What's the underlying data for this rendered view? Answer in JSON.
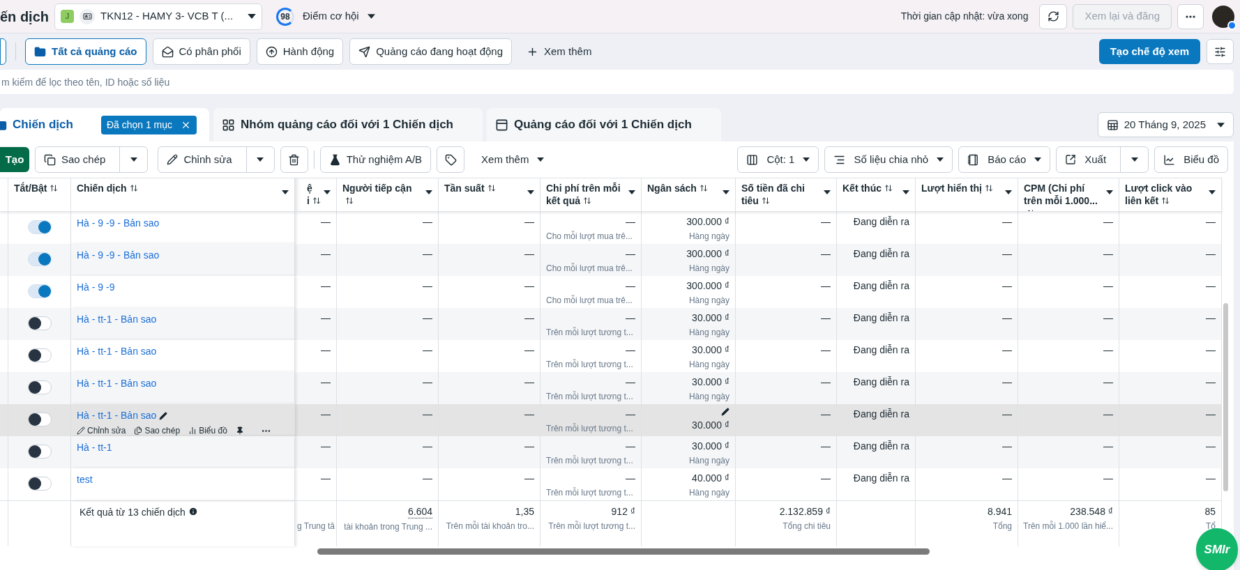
{
  "header": {
    "title": "ến dịch",
    "account_initial": "J",
    "account": "TKN12 - HAMY 3- VCB T (...",
    "score": "98",
    "score_label": "Điểm cơ hội",
    "updated": "Thời gian cập nhật: vừa xong",
    "review_button": {
      "label": "Xem lại và đăng",
      "disabled": true
    }
  },
  "filters": [
    {
      "label": "Tất cả quảng cáo",
      "selected": true
    },
    {
      "label": "Có phân phối",
      "selected": false
    },
    {
      "label": "Hành động",
      "selected": false
    },
    {
      "label": "Quảng cáo đang hoạt động",
      "selected": false
    }
  ],
  "filters_more": "Xem thêm",
  "create_view": "Tạo chế độ xem",
  "search": {
    "placeholder": "m kiếm để lọc theo tên, ID hoặc số liệu"
  },
  "tabs": [
    {
      "label": "Chiến dịch",
      "selected": true,
      "badge": "Đã chọn 1 mục"
    },
    {
      "label": "Nhóm quảng cáo đối với 1 Chiến dịch",
      "selected": false
    },
    {
      "label": "Quảng cáo đối với 1 Chiến dịch",
      "selected": false
    }
  ],
  "date": "20 Tháng 9, 2025",
  "toolbar": {
    "create": "Tạo",
    "copy": "Sao chép",
    "edit": "Chỉnh sửa",
    "ab_test": "Thử nghiệm A/B",
    "more": "Xem thêm",
    "columns": "Cột: 1",
    "breakdown": "Số liệu chia nhỏ",
    "reports": "Báo cáo",
    "export": "Xuất",
    "chart": "Biểu đồ"
  },
  "columns": [
    {
      "label": "Tắt/Bật",
      "sortable": true,
      "menu": false
    },
    {
      "label": "Chiến dịch",
      "sortable": true,
      "menu": true
    },
    {
      "label": "ệ\ni",
      "sortable": true,
      "menu": true
    },
    {
      "label": "Người tiếp cận",
      "sortable": true,
      "menu": true
    },
    {
      "label": "Tần suất",
      "sortable": true,
      "menu": true
    },
    {
      "label": "Chi phí trên mỗi kết quả",
      "sortable": true,
      "menu": true
    },
    {
      "label": "Ngân sách",
      "sortable": true,
      "menu": true
    },
    {
      "label": "Số tiền đã chi tiêu",
      "sortable": true,
      "menu": true
    },
    {
      "label": "Kết thúc",
      "sortable": true,
      "menu": true
    },
    {
      "label": "Lượt hiển thị",
      "sortable": true,
      "menu": true
    },
    {
      "label": "CPM (Chi phí trên mỗi 1.000...",
      "sortable": true,
      "menu": true
    },
    {
      "label": "Lượt click vào liên kết",
      "sortable": true,
      "menu": true
    }
  ],
  "rows": [
    {
      "on": true,
      "hovered": false,
      "name": "Hà - 9 -9 - Bản sao",
      "cells": [
        {
          "value": "—"
        },
        {
          "value": "—"
        },
        {
          "value": "—"
        },
        {
          "value": "—",
          "note": "Cho mỗi lượt mua trê..."
        },
        {
          "value": "300.000 ₫",
          "note": "Hàng ngày"
        },
        {
          "value": "—"
        },
        {
          "value": "Đang diễn ra"
        },
        {
          "value": "—"
        },
        {
          "value": "—"
        },
        {
          "value": "—"
        }
      ]
    },
    {
      "on": true,
      "hovered": false,
      "name": "Hà - 9 -9 - Bản sao",
      "cells": [
        {
          "value": "—"
        },
        {
          "value": "—"
        },
        {
          "value": "—"
        },
        {
          "value": "—",
          "note": "Cho mỗi lượt mua trê..."
        },
        {
          "value": "300.000 ₫",
          "note": "Hàng ngày"
        },
        {
          "value": "—"
        },
        {
          "value": "Đang diễn ra"
        },
        {
          "value": "—"
        },
        {
          "value": "—"
        },
        {
          "value": "—"
        }
      ]
    },
    {
      "on": true,
      "hovered": false,
      "name": "Hà - 9 -9",
      "cells": [
        {
          "value": "—"
        },
        {
          "value": "—"
        },
        {
          "value": "—"
        },
        {
          "value": "—",
          "note": "Cho mỗi lượt mua trê..."
        },
        {
          "value": "300.000 ₫",
          "note": "Hàng ngày"
        },
        {
          "value": "—"
        },
        {
          "value": "Đang diễn ra"
        },
        {
          "value": "—"
        },
        {
          "value": "—"
        },
        {
          "value": "—"
        }
      ]
    },
    {
      "on": false,
      "hovered": false,
      "name": "Hà - tt-1 - Bản sao",
      "cells": [
        {
          "value": "—"
        },
        {
          "value": "—"
        },
        {
          "value": "—"
        },
        {
          "value": "—",
          "note": "Trên mỗi lượt tương t..."
        },
        {
          "value": "30.000 ₫",
          "note": "Hàng ngày"
        },
        {
          "value": "—"
        },
        {
          "value": "Đang diễn ra"
        },
        {
          "value": "—"
        },
        {
          "value": "—"
        },
        {
          "value": "—"
        }
      ]
    },
    {
      "on": false,
      "hovered": false,
      "name": "Hà - tt-1 - Bản sao",
      "cells": [
        {
          "value": "—"
        },
        {
          "value": "—"
        },
        {
          "value": "—"
        },
        {
          "value": "—",
          "note": "Trên mỗi lượt tương t..."
        },
        {
          "value": "30.000 ₫",
          "note": "Hàng ngày"
        },
        {
          "value": "—"
        },
        {
          "value": "Đang diễn ra"
        },
        {
          "value": "—"
        },
        {
          "value": "—"
        },
        {
          "value": "—"
        }
      ]
    },
    {
      "on": false,
      "hovered": false,
      "name": "Hà - tt-1 - Bản sao",
      "cells": [
        {
          "value": "—"
        },
        {
          "value": "—"
        },
        {
          "value": "—"
        },
        {
          "value": "—",
          "note": "Trên mỗi lượt tương t..."
        },
        {
          "value": "30.000 ₫",
          "note": "Hàng ngày"
        },
        {
          "value": "—"
        },
        {
          "value": "Đang diễn ra"
        },
        {
          "value": "—"
        },
        {
          "value": "—"
        },
        {
          "value": "—"
        }
      ]
    },
    {
      "on": false,
      "hovered": true,
      "name": "Hà - tt-1 - Bản sao",
      "actions": [
        "Chỉnh sửa",
        "Sao chép",
        "Biểu đồ"
      ],
      "cells": [
        {
          "value": "—"
        },
        {
          "value": "—"
        },
        {
          "value": "—"
        },
        {
          "value": "—",
          "note": "Trên mỗi lượt tương t..."
        },
        {
          "value": "30.000 ₫"
        },
        {
          "value": "—"
        },
        {
          "value": "Đang diễn ra"
        },
        {
          "value": "—"
        },
        {
          "value": "—"
        },
        {
          "value": "—"
        }
      ]
    },
    {
      "on": false,
      "hovered": false,
      "name": "Hà - tt-1",
      "cells": [
        {
          "value": "—"
        },
        {
          "value": "—"
        },
        {
          "value": "—"
        },
        {
          "value": "—",
          "note": "Trên mỗi lượt tương t..."
        },
        {
          "value": "30.000 ₫",
          "note": "Hàng ngày"
        },
        {
          "value": "—"
        },
        {
          "value": "Đang diễn ra"
        },
        {
          "value": "—"
        },
        {
          "value": "—"
        },
        {
          "value": "—"
        }
      ]
    },
    {
      "on": false,
      "hovered": false,
      "name": "test",
      "cells": [
        {
          "value": "—"
        },
        {
          "value": "—"
        },
        {
          "value": "—"
        },
        {
          "value": "—",
          "note": "Trên mỗi lượt tương t..."
        },
        {
          "value": "40.000 ₫",
          "note": "Hàng ngày"
        },
        {
          "value": "—"
        },
        {
          "value": "Đang diễn ra"
        },
        {
          "value": "—"
        },
        {
          "value": "—"
        },
        {
          "value": "—"
        }
      ]
    }
  ],
  "totals": {
    "label": "Kết quả từ 13 chiến dịch",
    "cells": [
      {
        "note": "g Trung tâ"
      },
      {
        "value": "6.604",
        "note": "tài khoản trong Trung ..."
      },
      {
        "value": "1,35",
        "note": "Trên mỗi tài khoản tro..."
      },
      {
        "value": "912 ₫",
        "note": "Trên mỗi lượt tương t..."
      },
      {},
      {
        "value": "2.132.859 ₫",
        "note": "Tổng chi tiêu"
      },
      {},
      {
        "value": "8.941",
        "note": "Tổng"
      },
      {
        "value": "238.548 ₫",
        "note": "Trên mỗi 1.000 lần hiể..."
      },
      {
        "value": "85",
        "note": "Tổ"
      }
    ]
  },
  "floating_button": "SMIr"
}
